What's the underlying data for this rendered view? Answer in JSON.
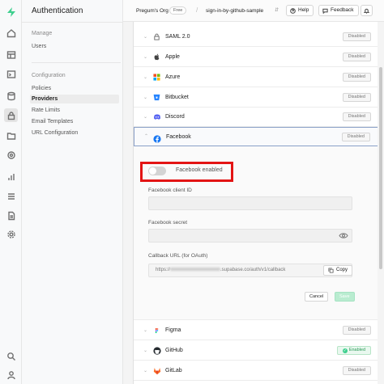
{
  "rail": {
    "icons": [
      "supabase-logo-icon",
      "home-icon",
      "table-editor-icon",
      "sql-editor-icon",
      "database-icon",
      "authentication-icon",
      "storage-icon",
      "edge-functions-icon",
      "reports-icon",
      "logs-icon",
      "api-docs-icon",
      "settings-icon",
      "search-icon",
      "user-icon"
    ]
  },
  "sidebar": {
    "title": "Authentication",
    "groups": [
      {
        "label": "Manage",
        "items": [
          "Users"
        ]
      },
      {
        "label": "Configuration",
        "items": [
          "Policies",
          "Providers",
          "Rate Limits",
          "Email Templates",
          "URL Configuration"
        ]
      }
    ],
    "active": "Providers"
  },
  "header": {
    "org": "Pregum's Org",
    "plan_badge": "Free",
    "project": "sign-in-by-github-sample",
    "help": "Help",
    "feedback": "Feedback"
  },
  "providers": [
    {
      "name": "SAML 2.0",
      "status": "Disabled",
      "icon": "lock-icon"
    },
    {
      "name": "Apple",
      "status": "Disabled",
      "icon": "apple-icon"
    },
    {
      "name": "Azure",
      "status": "Disabled",
      "icon": "azure-icon"
    },
    {
      "name": "Bitbucket",
      "status": "Disabled",
      "icon": "bitbucket-icon"
    },
    {
      "name": "Discord",
      "status": "Disabled",
      "icon": "discord-icon"
    }
  ],
  "facebook": {
    "name": "Facebook",
    "status": "Disabled",
    "toggle_label": "Facebook enabled",
    "enabled": false,
    "client_id_label": "Facebook client ID",
    "client_id_value": "",
    "secret_label": "Facebook secret",
    "secret_value": "",
    "callback_label": "Callback URL (for OAuth)",
    "callback_prefix": "https://",
    "callback_suffix": ".supabase.co/auth/v1/callback",
    "copy_label": "Copy",
    "cancel_label": "Cancel",
    "save_label": "Save"
  },
  "providers_after": [
    {
      "name": "Figma",
      "status": "Disabled",
      "icon": "figma-icon"
    },
    {
      "name": "GitHub",
      "status": "Enabled",
      "icon": "github-icon"
    },
    {
      "name": "GitLab",
      "status": "Disabled",
      "icon": "gitlab-icon"
    }
  ],
  "colors": {
    "brand": "#3ecf8e",
    "highlight": "#e31414",
    "facebook": "#1877f2"
  }
}
